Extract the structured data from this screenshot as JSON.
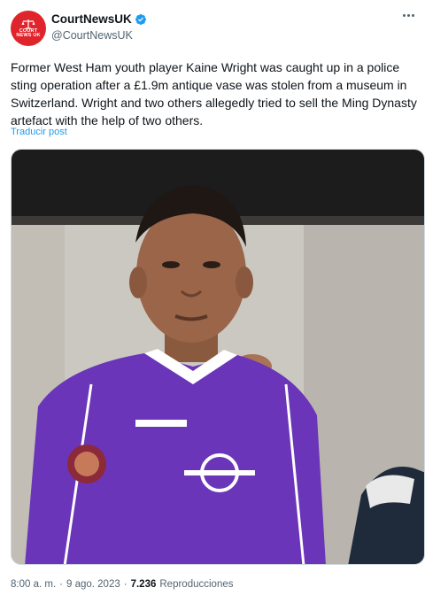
{
  "account": {
    "display_name": "CourtNewsUK",
    "handle": "@CourtNewsUK",
    "avatar_text_1": "COURT",
    "avatar_text_2": "NEWS UK",
    "verified": true,
    "brand_color": "#e0242b",
    "verified_color": "#1d9bf0"
  },
  "tweet": {
    "text": "Former West Ham youth player Kaine Wright was caught up in a police sting operation after a £1.9m antique vase was stolen from a museum in Switzerland. Wright and two others allegedly tried to sell the Ming Dynasty artefact with the help of two others.",
    "translate_label": "Traducir post"
  },
  "meta": {
    "time": "8:00 a. m.",
    "separator_1": "·",
    "date": "9 ago. 2023",
    "separator_2": "·",
    "views": "7.236",
    "views_label": "Reproducciones"
  },
  "icons": {
    "more": "more-horizontal-icon",
    "verified": "verified-badge-icon"
  }
}
